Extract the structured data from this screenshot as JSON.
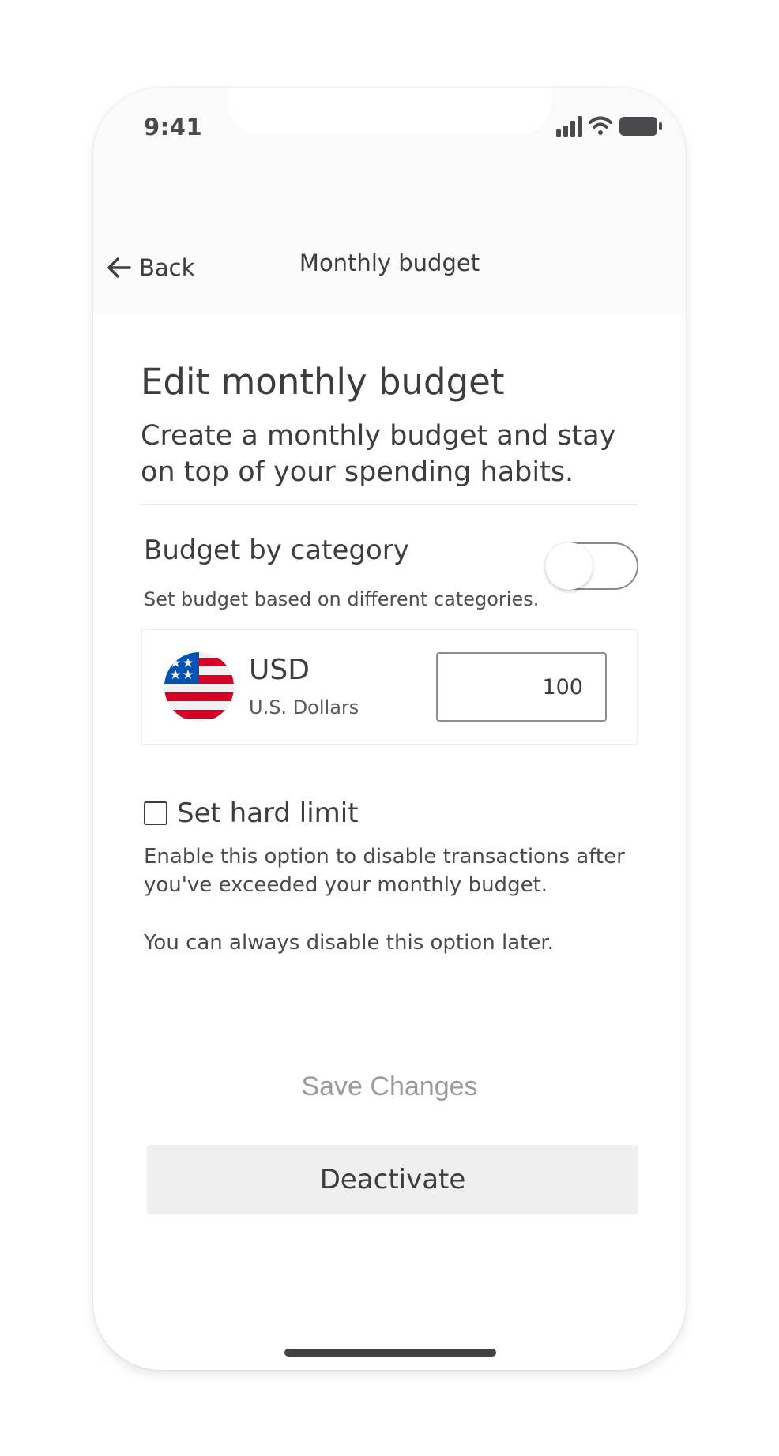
{
  "status_bar": {
    "time": "9:41",
    "icons": [
      "signal-icon",
      "wifi-icon",
      "battery-icon"
    ]
  },
  "nav": {
    "back_label": "Back",
    "title": "Monthly budget",
    "back_icon": "arrow-left-icon"
  },
  "page": {
    "title": "Edit monthly budget",
    "subtitle": "Create a monthly budget and stay on top of your spending habits."
  },
  "budget_by_category": {
    "label": "Budget by category",
    "description": "Set budget based on different categories.",
    "enabled": false
  },
  "currency": {
    "code": "USD",
    "name": "U.S. Dollars",
    "flag_icon": "us-flag-icon",
    "amount": "100"
  },
  "hard_limit": {
    "label": "Set hard limit",
    "checked": false,
    "help_1": "Enable this option to disable transactions after you've exceeded your monthly budget.",
    "help_2": "You can always disable this option later."
  },
  "actions": {
    "save_label": "Save Changes",
    "deactivate_label": "Deactivate"
  },
  "colors": {
    "text": "#3d3d3f",
    "muted_button_text": "#9a9a9c",
    "secondary_button_bg": "#efefef",
    "header_bg": "#fafafa"
  }
}
